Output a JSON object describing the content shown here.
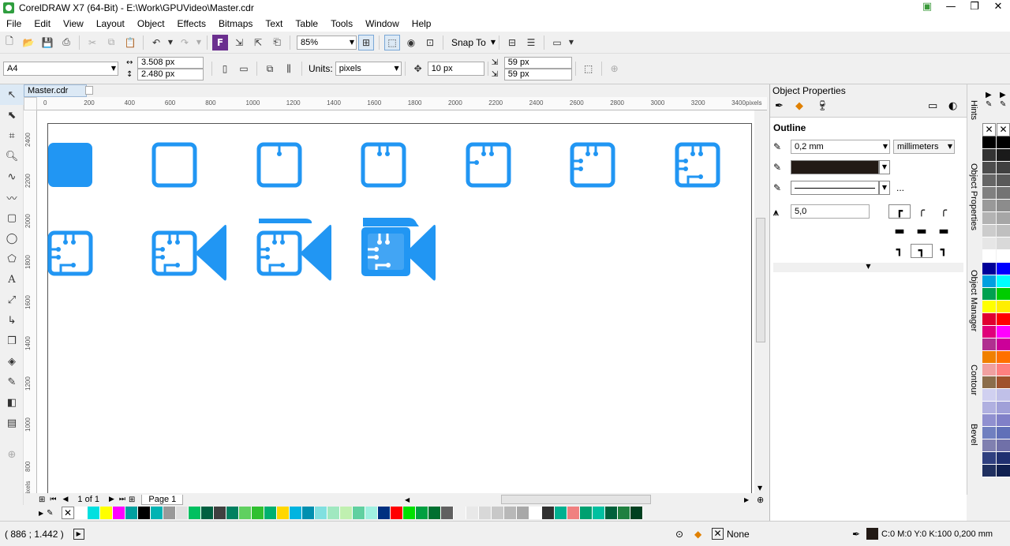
{
  "window": {
    "title": "CorelDRAW X7 (64-Bit) - E:\\Work\\GPUVideo\\Master.cdr",
    "min": "—",
    "max": "❐",
    "close": "✕"
  },
  "menu": [
    "File",
    "Edit",
    "View",
    "Layout",
    "Object",
    "Effects",
    "Bitmaps",
    "Text",
    "Table",
    "Tools",
    "Window",
    "Help"
  ],
  "toolbar": {
    "zoom": "85%",
    "snap_to": "Snap To"
  },
  "propbar": {
    "page_size": "A4",
    "width": "3.508 px",
    "height": "2.480 px",
    "units_label": "Units:",
    "units": "pixels",
    "nudge": "10 px",
    "dup_x": "59 px",
    "dup_y": "59 px"
  },
  "doc_tab": "Master.cdr",
  "ruler_h": [
    "0",
    "200",
    "400",
    "600",
    "800",
    "1000",
    "1200",
    "1400",
    "1600",
    "1800",
    "2000",
    "2200",
    "2400",
    "2600",
    "2800",
    "3000",
    "3200",
    "3400",
    "pixels"
  ],
  "ruler_v": [
    "2400",
    "2200",
    "2000",
    "1800",
    "1600",
    "1400",
    "1200",
    "1000",
    "800",
    "pixels"
  ],
  "pager": {
    "page_count": "1 of 1",
    "page_tab": "Page 1"
  },
  "panel": {
    "title": "Object Properties",
    "section": "Outline",
    "width": "0,2 mm",
    "units": "millimeters",
    "miter": "5,0",
    "more": "..."
  },
  "side_tabs": [
    "Hints",
    "Object Properties",
    "Object Manager",
    "Contour",
    "Bevel"
  ],
  "status": {
    "coords": "( 886  ; 1.442 )",
    "fill": "None",
    "outline": "C:0 M:0 Y:0 K:100  0,200 mm"
  },
  "colors": {
    "accent": "#2196f3",
    "icon_dark": "#1976d2"
  },
  "palette_h": [
    "#ffffff",
    "#00e0e0",
    "#ffff00",
    "#ff00ff",
    "#00a0a0",
    "#000000",
    "#00b3b3",
    "#999999",
    "#e0e0e0",
    "#00c060",
    "#006040",
    "#404040",
    "#008060",
    "#60d060",
    "#30c030",
    "#00b070",
    "#ffd700",
    "#00b4e0",
    "#0090b0",
    "#80e0e0",
    "#a0e8c0",
    "#c0f0b0",
    "#60d0a0",
    "#a0f0e0",
    "#003080",
    "#ff0000",
    "#00e000",
    "#00a040",
    "#007030",
    "#606060",
    "#f0f0f0",
    "#e8e8e8",
    "#d8d8d8",
    "#c8c8c8",
    "#b8b8b8",
    "#a8a8a8",
    "#ffffff",
    "#303030",
    "#00b090",
    "#f08080",
    "#00a070",
    "#00c0a0",
    "#00603a",
    "#208040",
    "#004020"
  ],
  "palette_v": [
    [
      "#000000",
      "#000000"
    ],
    [
      "#333333",
      "#1a1a1a"
    ],
    [
      "#4d4d4d",
      "#404040"
    ],
    [
      "#666666",
      "#595959"
    ],
    [
      "#808080",
      "#737373"
    ],
    [
      "#999999",
      "#8c8c8c"
    ],
    [
      "#b3b3b3",
      "#a6a6a6"
    ],
    [
      "#cccccc",
      "#bfbfbf"
    ],
    [
      "#e6e6e6",
      "#d9d9d9"
    ],
    [
      "#ffffff",
      "#ffffff"
    ],
    [
      "#000099",
      "#0000ff"
    ],
    [
      "#00a0e0",
      "#00ffff"
    ],
    [
      "#00a050",
      "#00cc00"
    ],
    [
      "#ffff00",
      "#ffee00"
    ],
    [
      "#e00030",
      "#ff0000"
    ],
    [
      "#e0007a",
      "#ff00ff"
    ],
    [
      "#b03090",
      "#cc0099"
    ],
    [
      "#f08000",
      "#ff7000"
    ],
    [
      "#f0a0a0",
      "#ff8080"
    ],
    [
      "#8b6d4b",
      "#a0522d"
    ],
    [
      "#d0d0f0",
      "#c0c0e8"
    ],
    [
      "#b0b0e0",
      "#a0a0d8"
    ],
    [
      "#9090d0",
      "#8080c8"
    ],
    [
      "#7080c0",
      "#6070b8"
    ],
    [
      "#8080b0",
      "#7070a8"
    ],
    [
      "#304080",
      "#203070"
    ],
    [
      "#203060",
      "#102050"
    ]
  ]
}
